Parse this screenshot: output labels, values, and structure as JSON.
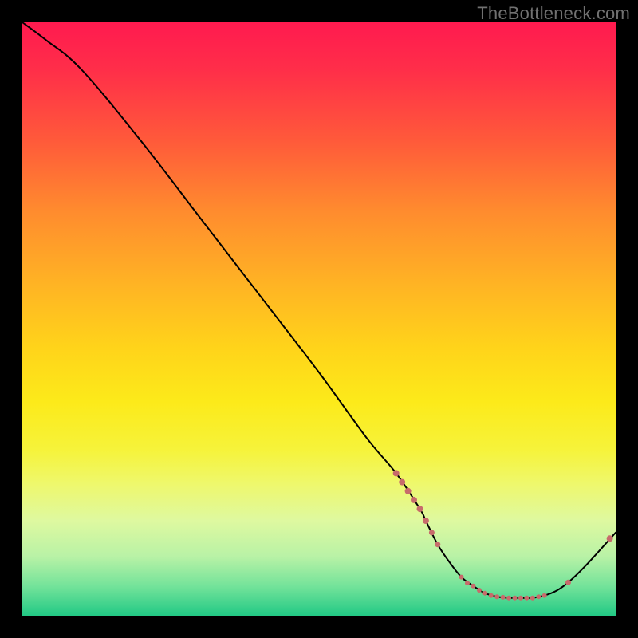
{
  "watermark": "TheBottleneck.com",
  "colors": {
    "background": "#000000",
    "gradient_top": "#ff1a4f",
    "gradient_mid": "#ffd41a",
    "gradient_bottom": "#22c985",
    "curve": "#000000",
    "marker": "#c76b6b"
  },
  "chart_data": {
    "type": "line",
    "title": "",
    "xlabel": "",
    "ylabel": "",
    "xlim": [
      0,
      100
    ],
    "ylim": [
      0,
      100
    ],
    "note": "No tick labels shown; x/y read as 0–100% of plot area. y values are bottleneck % (0 at bottom, 100 at top).",
    "series": [
      {
        "name": "bottleneck-curve",
        "x": [
          0,
          4,
          10,
          20,
          30,
          40,
          50,
          58,
          63,
          67,
          68,
          70,
          72,
          74,
          76,
          78,
          80,
          82,
          84,
          86,
          88,
          90,
          92,
          95,
          100
        ],
        "y": [
          100,
          97,
          92,
          80,
          67,
          54,
          41,
          30,
          24,
          18,
          16,
          12,
          9,
          6.5,
          5,
          3.8,
          3.2,
          3.0,
          3.0,
          3.0,
          3.4,
          4.2,
          5.6,
          8.5,
          14
        ]
      }
    ],
    "markers": {
      "name": "highlight-points",
      "points": [
        {
          "x": 63,
          "y": 24,
          "r": 4
        },
        {
          "x": 64,
          "y": 22.5,
          "r": 4
        },
        {
          "x": 65,
          "y": 21,
          "r": 4
        },
        {
          "x": 66,
          "y": 19.5,
          "r": 4
        },
        {
          "x": 67,
          "y": 18,
          "r": 4
        },
        {
          "x": 68,
          "y": 16,
          "r": 4
        },
        {
          "x": 69,
          "y": 14,
          "r": 3.5
        },
        {
          "x": 70,
          "y": 12,
          "r": 3.5
        },
        {
          "x": 74,
          "y": 6.5,
          "r": 3
        },
        {
          "x": 75,
          "y": 5.5,
          "r": 3
        },
        {
          "x": 76,
          "y": 5.0,
          "r": 3
        },
        {
          "x": 77,
          "y": 4.3,
          "r": 3
        },
        {
          "x": 78,
          "y": 3.8,
          "r": 3
        },
        {
          "x": 79,
          "y": 3.4,
          "r": 3
        },
        {
          "x": 80,
          "y": 3.2,
          "r": 3
        },
        {
          "x": 81,
          "y": 3.1,
          "r": 3
        },
        {
          "x": 82,
          "y": 3.0,
          "r": 3
        },
        {
          "x": 83,
          "y": 3.0,
          "r": 3
        },
        {
          "x": 84,
          "y": 3.0,
          "r": 3
        },
        {
          "x": 85,
          "y": 3.0,
          "r": 3
        },
        {
          "x": 86,
          "y": 3.0,
          "r": 3
        },
        {
          "x": 87,
          "y": 3.2,
          "r": 3
        },
        {
          "x": 88,
          "y": 3.4,
          "r": 3
        },
        {
          "x": 92,
          "y": 5.6,
          "r": 3.5
        },
        {
          "x": 99,
          "y": 13,
          "r": 4
        }
      ]
    }
  }
}
